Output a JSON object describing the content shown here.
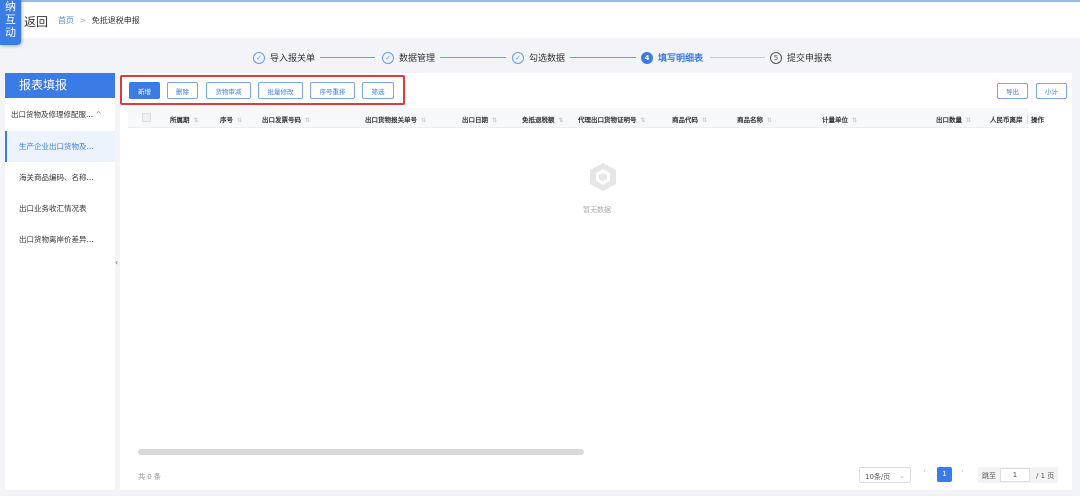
{
  "logo_text": "纳互动",
  "header": {
    "back": "返回",
    "breadcrumb": {
      "home": "首页",
      "sep": ">",
      "current": "免抵退税申报"
    }
  },
  "steps": [
    {
      "num": "✓",
      "label": "导入报关单",
      "state": "done"
    },
    {
      "num": "✓",
      "label": "数据管理",
      "state": "done"
    },
    {
      "num": "✓",
      "label": "勾选数据",
      "state": "done"
    },
    {
      "num": "4",
      "label": "填写明细表",
      "state": "active"
    },
    {
      "num": "5",
      "label": "提交申报表",
      "state": "todo"
    }
  ],
  "sidebar": {
    "title": "报表填报",
    "group": "出口货物及修理修配服...",
    "group_chevron": "^",
    "items": [
      {
        "label": "生产企业出口货物及..."
      },
      {
        "label": "海关商品编码、名称..."
      },
      {
        "label": "出口业务收汇情况表"
      },
      {
        "label": "出口货物离岸价差异..."
      }
    ]
  },
  "toolbar": {
    "buttons": [
      "新增",
      "删除",
      "货物审减",
      "批量修改",
      "序号重排",
      "筛选"
    ],
    "right": [
      "导出",
      "小计"
    ]
  },
  "table": {
    "columns": [
      "所属期",
      "序号",
      "出口发票号码",
      "出口货物报关单号",
      "出口日期",
      "免抵退税额",
      "代理出口货物证明号",
      "商品代码",
      "商品名称",
      "计量单位",
      "出口数量",
      "人民币离岸",
      "操作"
    ],
    "empty": "暂无数据"
  },
  "footer": {
    "total": "共 0 条",
    "page_size": "10条/页",
    "current_page": "1",
    "jump_label": "跳至",
    "jump_value": "1",
    "pages": "/ 1 页"
  },
  "colors": {
    "accent": "#3b7be6",
    "highlight": "#e03a3a"
  }
}
